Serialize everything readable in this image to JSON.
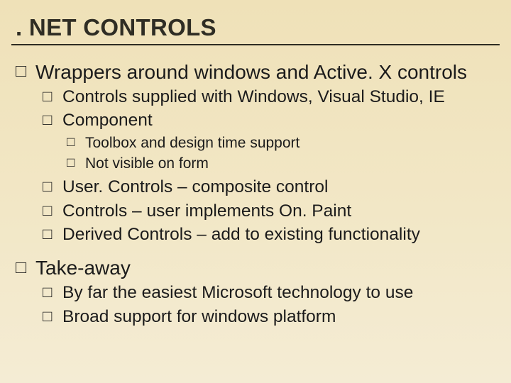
{
  "title": ". NET CONTROLS",
  "b": {
    "wrappers": "Wrappers around windows and Active. X controls",
    "controls_supplied": "Controls supplied with Windows, Visual Studio, IE",
    "component": "Component",
    "toolbox": "Toolbox and design time support",
    "not_visible": "Not visible on form",
    "usercontrols": "User. Controls – composite control",
    "controls_paint": "Controls – user implements On. Paint",
    "derived": "Derived Controls – add to existing functionality",
    "takeaway": "Take-away",
    "by_far": "By far the easiest Microsoft technology to use",
    "broad": "Broad support for windows platform"
  }
}
